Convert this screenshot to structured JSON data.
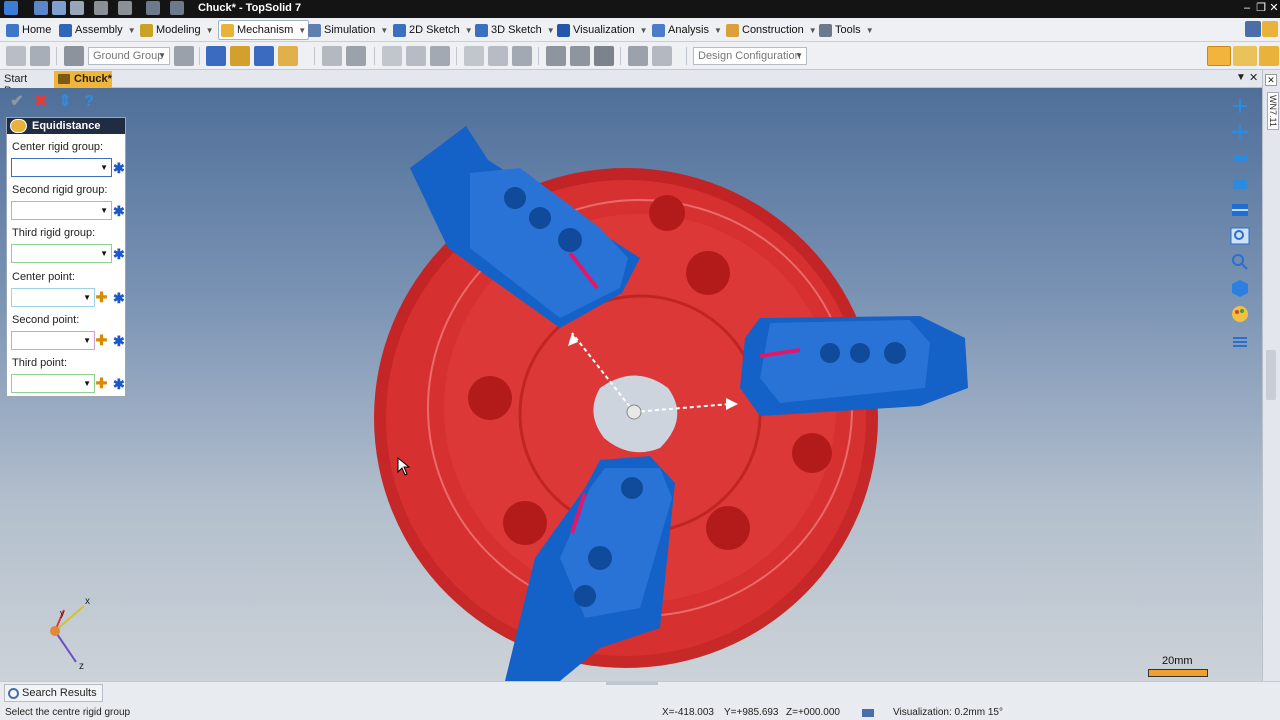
{
  "window": {
    "title": "Chuck* - TopSolid 7",
    "min": "–",
    "restore": "❐",
    "close": "✕"
  },
  "menus": [
    {
      "label": "Home"
    },
    {
      "label": "Assembly"
    },
    {
      "label": "Modeling"
    },
    {
      "label": "Mechanism"
    },
    {
      "label": "Simulation"
    },
    {
      "label": "2D Sketch"
    },
    {
      "label": "3D Sketch"
    },
    {
      "label": "Visualization"
    },
    {
      "label": "Analysis"
    },
    {
      "label": "Construction"
    },
    {
      "label": "Tools"
    }
  ],
  "toolbar": {
    "ground_group": "Ground Group",
    "design_configuration": "Design Configuration"
  },
  "doc_tabs": {
    "start_page": "Start Page",
    "chuck": "Chuck*"
  },
  "right_strip": {
    "label": "WN7.11"
  },
  "panel": {
    "title": "Equidistance",
    "fields": [
      {
        "label": "Center rigid group:"
      },
      {
        "label": "Second rigid group:"
      },
      {
        "label": "Third rigid group:"
      },
      {
        "label": "Center point:"
      },
      {
        "label": "Second point:"
      },
      {
        "label": "Third point:"
      }
    ],
    "marker": "✱",
    "plus": "✚"
  },
  "panel_actions": {
    "ok": "✔",
    "cancel": "✖",
    "pin": "⇕",
    "help": "?"
  },
  "triad": {
    "x": "x",
    "y": "y",
    "z": "z"
  },
  "scale": {
    "label": "20mm"
  },
  "status": {
    "search_results": "Search Results",
    "prompt": "Select the centre rigid group",
    "x": "X=-418.003",
    "y": "Y=+985.693",
    "z": "Z=+000.000",
    "visualization": "Visualization: 0.2mm 15°"
  },
  "colors": {
    "chuck_body": "#d92626",
    "jaws": "#1461c8",
    "accent": "#e9b23b",
    "panel_header": "#1f2c42"
  }
}
